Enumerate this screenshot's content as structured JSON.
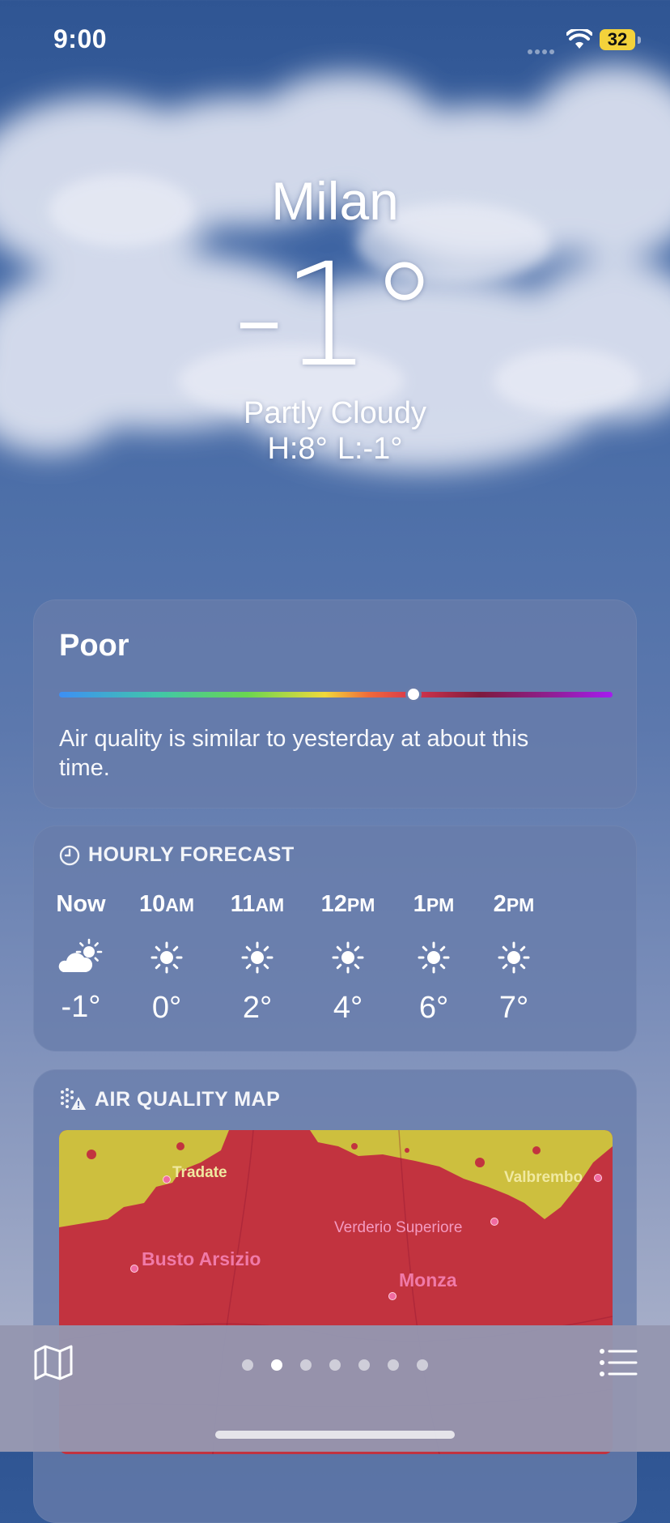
{
  "status": {
    "time": "9:00",
    "battery": "32"
  },
  "current": {
    "city": "Milan",
    "temperature": "-1°",
    "condition": "Partly Cloudy",
    "high": "H:8°",
    "low": "L:-1°"
  },
  "air_quality": {
    "level": "Poor",
    "scale_position_fraction": 0.64,
    "description": "Air quality is similar to yesterday at about this time."
  },
  "hourly": {
    "title": "HOURLY FORECAST",
    "icon": "clock-icon",
    "items": [
      {
        "time": "Now",
        "suffix": "",
        "icon": "partly-cloudy-icon",
        "temp": "-1°"
      },
      {
        "time": "10",
        "suffix": "AM",
        "icon": "sun-icon",
        "temp": "0°"
      },
      {
        "time": "11",
        "suffix": "AM",
        "icon": "sun-icon",
        "temp": "2°"
      },
      {
        "time": "12",
        "suffix": "PM",
        "icon": "sun-icon",
        "temp": "4°"
      },
      {
        "time": "1",
        "suffix": "PM",
        "icon": "sun-icon",
        "temp": "6°"
      },
      {
        "time": "2",
        "suffix": "PM",
        "icon": "sun-icon",
        "temp": "7°"
      }
    ]
  },
  "aq_map": {
    "title": "AIR QUALITY MAP",
    "icon": "air-quality-warning-icon",
    "places": [
      "Tradate",
      "Valbrembo",
      "Verderio Superiore",
      "Busto Arsizio",
      "Monza"
    ],
    "colors": {
      "poor": "#c2333f",
      "moderate": "#cdbf3e"
    }
  },
  "pager": {
    "count": 7,
    "active_index": 1
  },
  "tabbar": {
    "left_icon": "map-icon",
    "right_icon": "list-icon"
  }
}
